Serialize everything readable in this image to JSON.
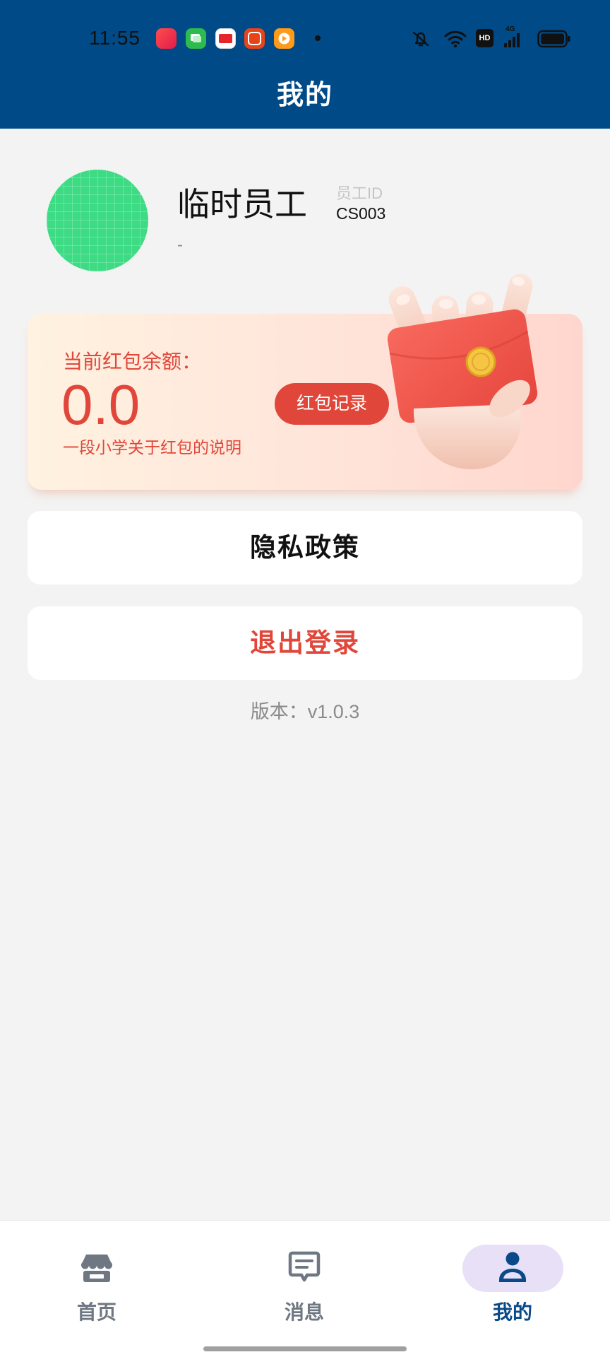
{
  "status_bar": {
    "time": "11:55",
    "notification_icons": [
      "shopping-app-icon",
      "chat-app-icon",
      "news-app-icon",
      "taobao-app-icon",
      "video-app-icon"
    ],
    "system_icons": [
      "mute-bell-icon",
      "wifi-icon",
      "hd-icon",
      "signal-icon",
      "battery-icon"
    ],
    "hd_label": "HD",
    "network_label": "4G"
  },
  "header": {
    "title": "我的"
  },
  "profile": {
    "name": "临时员工",
    "id_label": "员工ID",
    "id_value": "CS003",
    "subtitle": "-"
  },
  "red_packet": {
    "label": "当前红包余额：",
    "amount": "0.0",
    "description": "一段小学关于红包的说明",
    "records_button": "红包记录"
  },
  "menu": {
    "privacy_label": "隐私政策",
    "logout_label": "退出登录"
  },
  "version": "版本：v1.0.3",
  "bottom_nav": {
    "items": [
      {
        "label": "首页",
        "icon": "store-icon",
        "active": false
      },
      {
        "label": "消息",
        "icon": "message-icon",
        "active": false
      },
      {
        "label": "我的",
        "icon": "person-icon",
        "active": true
      }
    ]
  },
  "colors": {
    "header": "#004a87",
    "background": "#f3f3f3",
    "accent_red": "#e0473a",
    "nav_active": "#0a4a88",
    "nav_active_bg": "#e8e0f6",
    "nav_inactive": "#6e7782",
    "avatar": "#3ddc84"
  }
}
